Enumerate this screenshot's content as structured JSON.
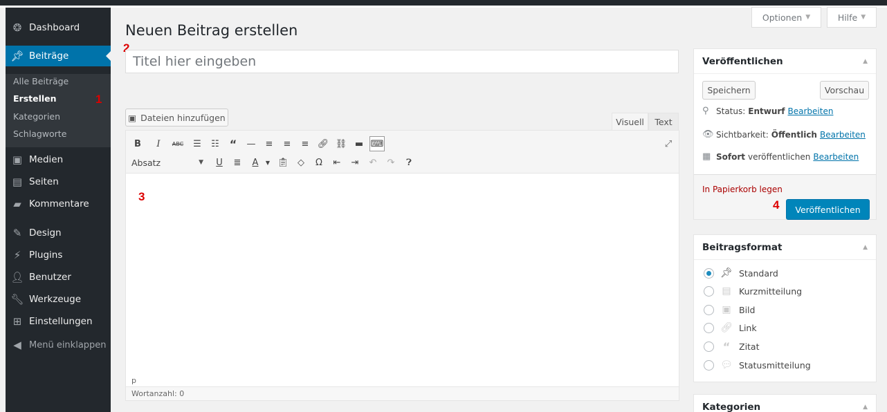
{
  "sidebar": {
    "dashboard": "Dashboard",
    "posts": "Beiträge",
    "submenu": [
      "Alle Beiträge",
      "Erstellen",
      "Kategorien",
      "Schlagworte"
    ],
    "media": "Medien",
    "pages": "Seiten",
    "comments": "Kommentare",
    "design": "Design",
    "plugins": "Plugins",
    "users": "Benutzer",
    "tools": "Werkzeuge",
    "settings": "Einstellungen",
    "collapse": "Menü einklappen"
  },
  "markers": [
    "1",
    "2",
    "3",
    "4"
  ],
  "header": {
    "title": "Neuen Beitrag erstellen",
    "options": "Optionen",
    "help": "Hilfe"
  },
  "editor": {
    "title_placeholder": "Titel hier eingeben",
    "add_media": "Dateien hinzufügen",
    "tab_visual": "Visuell",
    "tab_text": "Text",
    "format_select": "Absatz",
    "path": "p",
    "word_count": "Wortanzahl: 0"
  },
  "publish": {
    "heading": "Veröffentlichen",
    "save": "Speichern",
    "preview": "Vorschau",
    "status_label": "Status:",
    "status_value": "Entwurf",
    "visibility_label": "Sichtbarkeit:",
    "visibility_value": "Öffentlich",
    "schedule_bold": "Sofort",
    "schedule_rest": "veröffentlichen",
    "edit": "Bearbeiten",
    "trash": "In Papierkorb legen",
    "publish_btn": "Veröffentlichen"
  },
  "post_format": {
    "heading": "Beitragsformat",
    "options": [
      "Standard",
      "Kurzmitteilung",
      "Bild",
      "Link",
      "Zitat",
      "Statusmitteilung"
    ],
    "selected": "Standard"
  },
  "categories": {
    "heading": "Kategorien"
  }
}
